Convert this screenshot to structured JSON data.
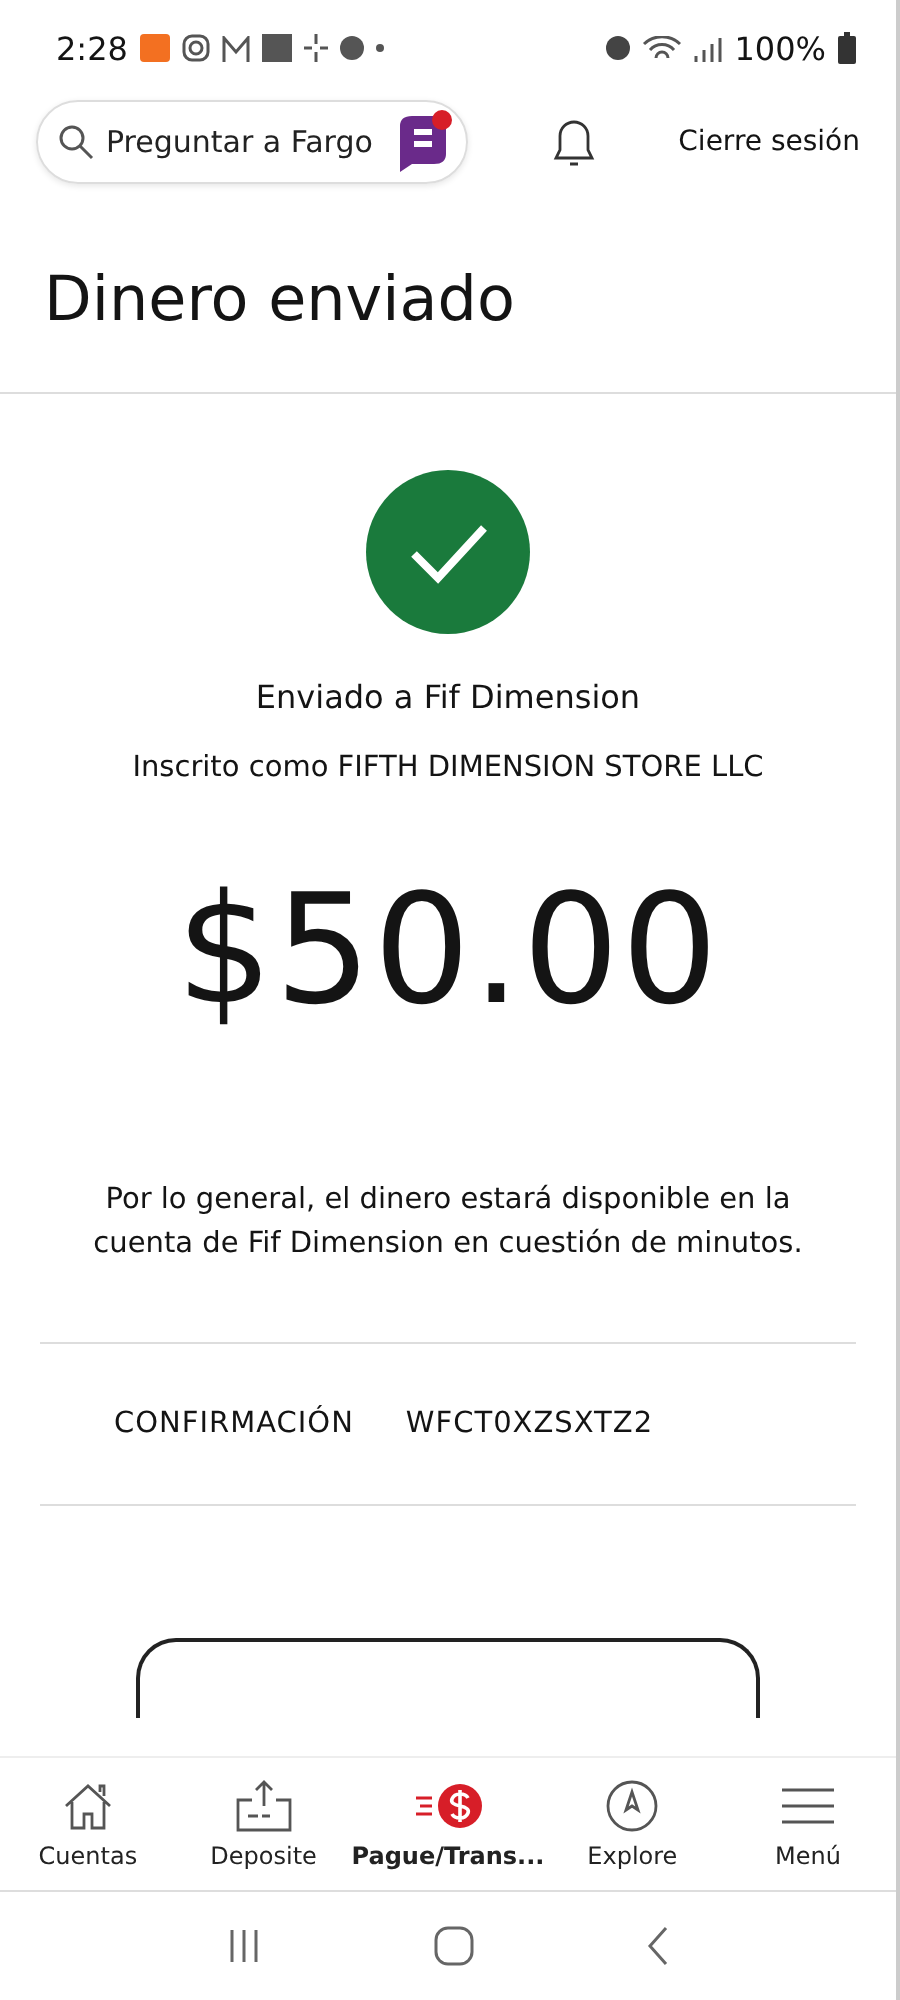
{
  "status_bar": {
    "time": "2:28",
    "battery": "100%"
  },
  "header": {
    "search_placeholder": "Preguntar a Fargo",
    "logout": "Cierre sesión"
  },
  "title": "Dinero enviado",
  "confirmation": {
    "sent_to": "Enviado a Fif Dimension",
    "enrolled_as": "Inscrito como FIFTH DIMENSION STORE LLC",
    "amount": "$50.00",
    "note": "Por lo general, el dinero estará disponible en la cuenta de Fif Dimension en cuestión de minutos.",
    "label": "CONFIRMACIÓN",
    "code": "WFCT0XZSXTZ2"
  },
  "bottom_nav": [
    {
      "kind": "home",
      "label": "Cuentas",
      "selected": false
    },
    {
      "kind": "deposit",
      "label": "Deposite",
      "selected": false
    },
    {
      "kind": "pay",
      "label": "Pague/Trans...",
      "selected": true
    },
    {
      "kind": "explore",
      "label": "Explore",
      "selected": false
    },
    {
      "kind": "menu",
      "label": "Menú",
      "selected": false
    }
  ]
}
